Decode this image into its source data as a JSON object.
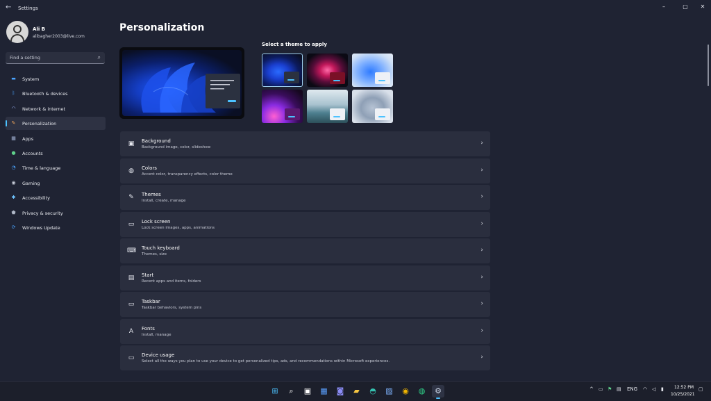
{
  "window": {
    "title": "Settings",
    "back_icon": "arrow-left-icon",
    "controls": {
      "minimize": "–",
      "maximize": "▢",
      "close": "✕"
    }
  },
  "profile": {
    "name": "Ali B",
    "email": "alibagher2003@live.com",
    "avatar_icon": "person-icon"
  },
  "search": {
    "placeholder": "Find a setting",
    "icon": "search-icon"
  },
  "sidebar": {
    "items": [
      {
        "label": "System",
        "icon": "monitor-icon",
        "color": "#4aa3ff",
        "glyph": "▬"
      },
      {
        "label": "Bluetooth & devices",
        "icon": "bluetooth-icon",
        "color": "#4aa3ff",
        "glyph": "ᛒ"
      },
      {
        "label": "Network & internet",
        "icon": "wifi-icon",
        "color": "#9fb8ff",
        "glyph": "◠"
      },
      {
        "label": "Personalization",
        "icon": "brush-icon",
        "color": "#f2a65a",
        "glyph": "✎",
        "active": true
      },
      {
        "label": "Apps",
        "icon": "apps-icon",
        "color": "#a3b4d6",
        "glyph": "▦"
      },
      {
        "label": "Accounts",
        "icon": "person-icon",
        "color": "#5fd18b",
        "glyph": "●"
      },
      {
        "label": "Time & language",
        "icon": "globe-clock-icon",
        "color": "#4aa3ff",
        "glyph": "◔"
      },
      {
        "label": "Gaming",
        "icon": "gamepad-icon",
        "color": "#c5cad6",
        "glyph": "◉"
      },
      {
        "label": "Accessibility",
        "icon": "accessibility-icon",
        "color": "#6fc3ff",
        "glyph": "✱"
      },
      {
        "label": "Privacy & security",
        "icon": "shield-icon",
        "color": "#b0b8c8",
        "glyph": "⬟"
      },
      {
        "label": "Windows Update",
        "icon": "update-icon",
        "color": "#4aa3ff",
        "glyph": "⟳"
      }
    ]
  },
  "main": {
    "title": "Personalization",
    "theme_heading": "Select a theme to apply",
    "themes": [
      {
        "name": "windows-dark",
        "selected": true,
        "bg": "radial-gradient(ellipse at 40% 55%, #2a6bff 0%, #1a3fd0 30%, #0c1b5e 60%, #0a0f24 90%)",
        "mini": "#2b3140"
      },
      {
        "name": "glow",
        "bg": "radial-gradient(ellipse at 50% 50%, #ff6aa8 0%, #c2185b 25%, #5a0d3a 50%, #0b0a14 80%)",
        "mini": "#7a1026"
      },
      {
        "name": "windows-light",
        "bg": "radial-gradient(ellipse at 45% 55%, #2f7bff 0%, #7fb0ff 40%, #cfe0f5 75%, #e8eef7 100%)",
        "mini": "#eef1f6"
      },
      {
        "name": "captured-motion",
        "bg": "radial-gradient(ellipse at 30% 80%, #ff5fd1 0%, #8a2be2 30%, #3a0d5c 60%, #16081f 90%)",
        "mini": "#5a1a6e"
      },
      {
        "name": "flow",
        "bg": "linear-gradient(180deg, #dfe9ef 0%, #a8c2cf 45%, #4d7f8f 70%, #2c4f5a 100%)",
        "mini": "#eef1f6"
      },
      {
        "name": "sunrise",
        "bg": "radial-gradient(ellipse at 50% 55%, #b6c3d4 0%, #8fa0b6 40%, #d9e0ea 80%)",
        "mini": "#eef1f6"
      }
    ],
    "settings": [
      {
        "title": "Background",
        "subtitle": "Background image, color, slideshow",
        "icon": "image-icon",
        "glyph": "▣"
      },
      {
        "title": "Colors",
        "subtitle": "Accent color, transparency effects, color theme",
        "icon": "palette-icon",
        "glyph": "◍"
      },
      {
        "title": "Themes",
        "subtitle": "Install, create, manage",
        "icon": "brush-icon",
        "glyph": "✎"
      },
      {
        "title": "Lock screen",
        "subtitle": "Lock screen images, apps, animations",
        "icon": "lock-screen-icon",
        "glyph": "▭"
      },
      {
        "title": "Touch keyboard",
        "subtitle": "Themes, size",
        "icon": "keyboard-icon",
        "glyph": "⌨"
      },
      {
        "title": "Start",
        "subtitle": "Recent apps and items, folders",
        "icon": "start-menu-icon",
        "glyph": "▤"
      },
      {
        "title": "Taskbar",
        "subtitle": "Taskbar behaviors, system pins",
        "icon": "taskbar-icon",
        "glyph": "▭"
      },
      {
        "title": "Fonts",
        "subtitle": "Install, manage",
        "icon": "font-icon",
        "glyph": "A"
      },
      {
        "title": "Device usage",
        "subtitle": "Select all the ways you plan to use your device to get personalized tips, ads, and recommendations within Microsoft experiences.",
        "icon": "device-usage-icon",
        "glyph": "▭"
      }
    ],
    "chevron": "›"
  },
  "taskbar": {
    "apps": [
      {
        "name": "start-button",
        "icon": "windows-logo-icon",
        "glyph": "⊞",
        "color": "#4cc2ff"
      },
      {
        "name": "search-button",
        "icon": "search-icon",
        "glyph": "⌕",
        "color": "#ffffff"
      },
      {
        "name": "task-view-button",
        "icon": "task-view-icon",
        "glyph": "▣",
        "color": "#ffffff"
      },
      {
        "name": "widgets-button",
        "icon": "widgets-icon",
        "glyph": "▦",
        "color": "#5aa0ff"
      },
      {
        "name": "teams-chat-button",
        "icon": "chat-icon",
        "glyph": "◙",
        "color": "#8b8cf5"
      },
      {
        "name": "file-explorer-button",
        "icon": "folder-icon",
        "glyph": "▰",
        "color": "#f5c542"
      },
      {
        "name": "edge-button",
        "icon": "edge-icon",
        "glyph": "◓",
        "color": "#35c1b0"
      },
      {
        "name": "photos-button",
        "icon": "photos-icon",
        "glyph": "▨",
        "color": "#7fb4ff"
      },
      {
        "name": "chrome-button",
        "icon": "chrome-icon",
        "glyph": "◉",
        "color": "#f0b400"
      },
      {
        "name": "app-button",
        "icon": "globe-icon",
        "glyph": "◍",
        "color": "#2fd48a"
      },
      {
        "name": "settings-app-button",
        "icon": "gear-icon",
        "glyph": "⚙",
        "color": "#c9d3e4",
        "active": true
      }
    ],
    "tray": {
      "chevron_icon": "^",
      "language": "ENG",
      "time": "12:52 PM",
      "date": "10/25/2021"
    }
  }
}
